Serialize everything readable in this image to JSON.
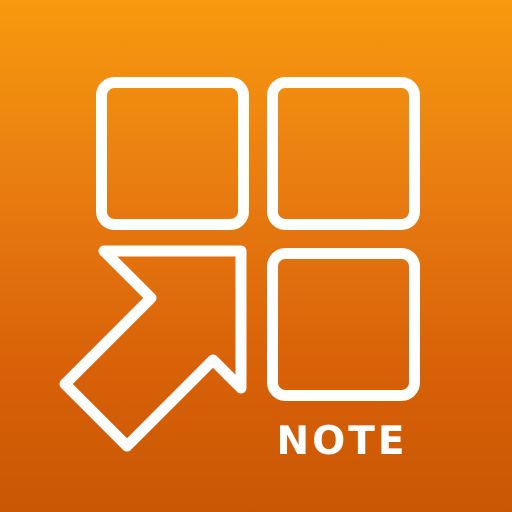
{
  "icon": {
    "label": "NOTE",
    "symbol": "four-square-grid-with-expand-arrow-icon",
    "colors": {
      "gradient_top": "#f79a0e",
      "gradient_bottom": "#c95704",
      "foreground": "#ffffff"
    }
  }
}
